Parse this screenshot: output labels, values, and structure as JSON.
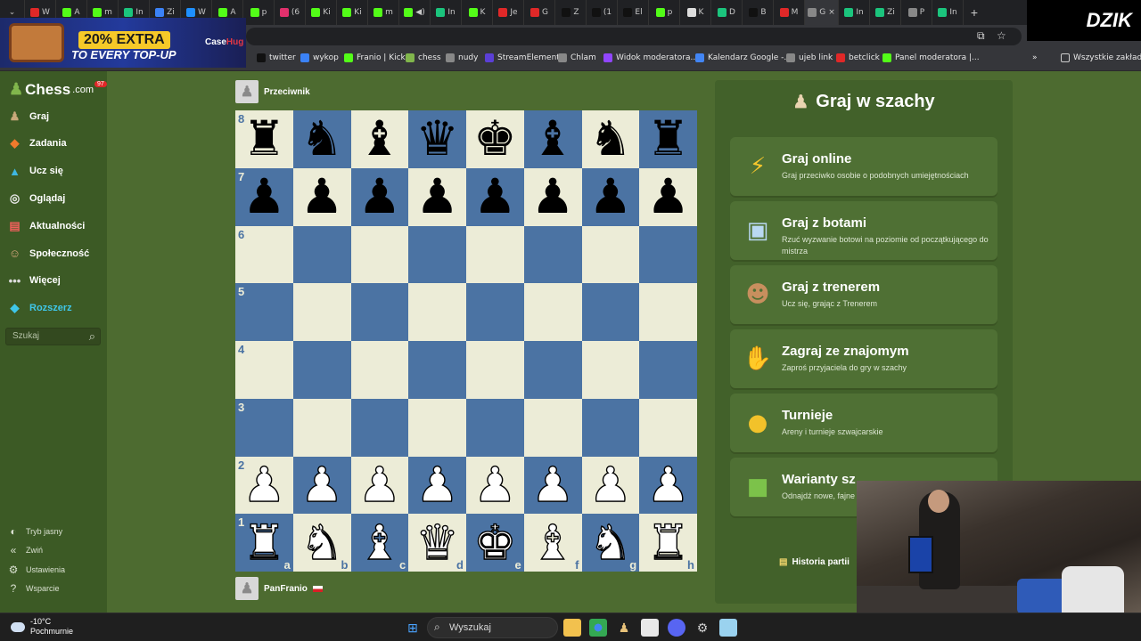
{
  "browser": {
    "tabs": [
      {
        "label": "W",
        "color": "#e02828"
      },
      {
        "label": "A",
        "color": "#53fc18"
      },
      {
        "label": "m",
        "color": "#53fc18"
      },
      {
        "label": "In",
        "color": "#1bc47d"
      },
      {
        "label": "Zi",
        "color": "#3b82f6"
      },
      {
        "label": "W",
        "color": "#1e90ff"
      },
      {
        "label": "A",
        "color": "#53fc18"
      },
      {
        "label": "p",
        "color": "#53fc18"
      },
      {
        "label": "(6",
        "color": "#e1306c"
      },
      {
        "label": "Ki",
        "color": "#53fc18"
      },
      {
        "label": "Ki",
        "color": "#53fc18"
      },
      {
        "label": "m",
        "color": "#53fc18"
      },
      {
        "label": "◀)",
        "color": "#53fc18"
      },
      {
        "label": "In",
        "color": "#1bc47d"
      },
      {
        "label": "K",
        "color": "#53fc18"
      },
      {
        "label": "Je",
        "color": "#e02828"
      },
      {
        "label": "G",
        "color": "#e02828"
      },
      {
        "label": "Z",
        "color": "#111111"
      },
      {
        "label": "(1",
        "color": "#111111"
      },
      {
        "label": "El",
        "color": "#111111"
      },
      {
        "label": "p",
        "color": "#53fc18"
      },
      {
        "label": "K",
        "color": "#dddddd"
      },
      {
        "label": "D",
        "color": "#1bc47d"
      },
      {
        "label": "B",
        "color": "#111111"
      },
      {
        "label": "M",
        "color": "#e02828"
      },
      {
        "label": "G",
        "color": "#888888"
      },
      {
        "label": "In",
        "color": "#1bc47d"
      },
      {
        "label": "Zi",
        "color": "#1bc47d"
      },
      {
        "label": "P",
        "color": "#888888"
      },
      {
        "label": "In",
        "color": "#1bc47d"
      }
    ],
    "active_tab_index": 25,
    "new_tab": "+",
    "bookmarks": [
      {
        "label": "twitter",
        "color": "#111111"
      },
      {
        "label": "wykop",
        "color": "#3b82f6"
      },
      {
        "label": "Franio | Kick",
        "color": "#53fc18"
      },
      {
        "label": "chess",
        "color": "#81b64c"
      },
      {
        "label": "nudy",
        "color": "#888888"
      },
      {
        "label": "StreamElements",
        "color": "#5b3fd6"
      },
      {
        "label": "Chlam",
        "color": "#888888"
      },
      {
        "label": "Widok moderatora...",
        "color": "#9146ff"
      },
      {
        "label": "Kalendarz Google -...",
        "color": "#4285f4"
      },
      {
        "label": "ujeb link",
        "color": "#888888"
      },
      {
        "label": "betclick",
        "color": "#e02828"
      },
      {
        "label": "Panel moderatora |...",
        "color": "#53fc18"
      }
    ],
    "all_bookmarks": "Wszystkie zakładki"
  },
  "ad": {
    "extra": "20% EXTRA",
    "sub": "TO EVERY TOP-UP",
    "brand_a": "Case",
    "brand_b": "Hug"
  },
  "overlay": {
    "streamer_logo": "DZIK"
  },
  "sidebar": {
    "logo_a": "Chess",
    "logo_b": ".com",
    "badge": "97",
    "items": [
      {
        "label": "Graj",
        "icon": "play-icon",
        "glyph": "♟",
        "color": "#c9a97a"
      },
      {
        "label": "Zadania",
        "icon": "puzzle-icon",
        "glyph": "◆",
        "color": "#f07a2c"
      },
      {
        "label": "Ucz się",
        "icon": "learn-icon",
        "glyph": "▲",
        "color": "#3fb7e2"
      },
      {
        "label": "Oglądaj",
        "icon": "watch-icon",
        "glyph": "◎",
        "color": "#e8e8e8"
      },
      {
        "label": "Aktualności",
        "icon": "news-icon",
        "glyph": "▤",
        "color": "#f0605c"
      },
      {
        "label": "Społeczność",
        "icon": "community-icon",
        "glyph": "☺",
        "color": "#d9a97f"
      },
      {
        "label": "Więcej",
        "icon": "more-icon",
        "glyph": "•••",
        "color": "#dddddd"
      },
      {
        "label": "Rozszerz",
        "icon": "diamond-icon",
        "glyph": "◆",
        "color": "#3fc6e8"
      }
    ],
    "search_placeholder": "Szukaj",
    "footer": [
      {
        "label": "Tryb jasny",
        "icon": "light-mode-icon",
        "glyph": "◐"
      },
      {
        "label": "Zwiń",
        "icon": "collapse-icon",
        "glyph": "«"
      },
      {
        "label": "Ustawienia",
        "icon": "settings-icon",
        "glyph": "⚙"
      },
      {
        "label": "Wsparcie",
        "icon": "help-icon",
        "glyph": "?"
      }
    ]
  },
  "game": {
    "opponent": "Przeciwnik",
    "player": "PanFranio",
    "position": [
      [
        "br",
        "bn",
        "bb",
        "bq",
        "bk",
        "bb",
        "bn",
        "br"
      ],
      [
        "bp",
        "bp",
        "bp",
        "bp",
        "bp",
        "bp",
        "bp",
        "bp"
      ],
      [
        "",
        "",
        "",
        "",
        "",
        "",
        "",
        ""
      ],
      [
        "",
        "",
        "",
        "",
        "",
        "",
        "",
        ""
      ],
      [
        "",
        "",
        "",
        "",
        "",
        "",
        "",
        ""
      ],
      [
        "",
        "",
        "",
        "",
        "",
        "",
        "",
        ""
      ],
      [
        "wp",
        "wp",
        "wp",
        "wp",
        "wp",
        "wp",
        "wp",
        "wp"
      ],
      [
        "wr",
        "wn",
        "wb",
        "wq",
        "wk",
        "wb",
        "wn",
        "wr"
      ]
    ],
    "ranks": [
      "8",
      "7",
      "6",
      "5",
      "4",
      "3",
      "2",
      "1"
    ],
    "files": [
      "a",
      "b",
      "c",
      "d",
      "e",
      "f",
      "g",
      "h"
    ]
  },
  "panel": {
    "title": "Graj w szachy",
    "options": [
      {
        "title": "Graj online",
        "desc": "Graj przeciwko osobie o podobnych umiejętnościach",
        "icon": "lightning-icon",
        "glyph": "⚡",
        "color": "#f7c72c"
      },
      {
        "title": "Graj z botami",
        "desc": "Rzuć wyzwanie botowi na poziomie od początkującego do mistrza",
        "icon": "robot-icon",
        "glyph": "▣",
        "color": "#b9d8f2"
      },
      {
        "title": "Graj z trenerem",
        "desc": "Ucz się, grając z Trenerem",
        "icon": "coach-icon",
        "glyph": "☻",
        "color": "#c88f5e"
      },
      {
        "title": "Zagraj ze znajomym",
        "desc": "Zaproś przyjaciela do gry w szachy",
        "icon": "handshake-icon",
        "glyph": "✋",
        "color": "#e3b58d"
      },
      {
        "title": "Turnieje",
        "desc": "Areny i turnieje szwajcarskie",
        "icon": "medal-icon",
        "glyph": "●",
        "color": "#f2c22a"
      },
      {
        "title": "Warianty sz",
        "desc": "Odnajdź nowe, fajne",
        "icon": "variants-icon",
        "glyph": "■",
        "color": "#7cc24a"
      }
    ],
    "history": "Historia partii"
  },
  "taskbar": {
    "temp": "-10°C",
    "weather": "Pochmurnie",
    "search": "Wyszukaj"
  }
}
